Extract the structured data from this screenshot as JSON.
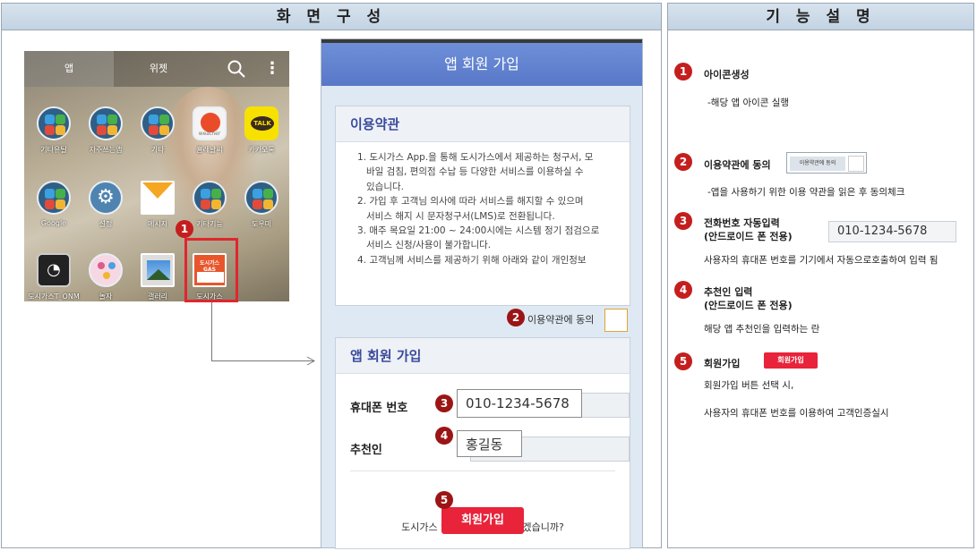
{
  "left_panel": {
    "title": "화 면 구 성"
  },
  "right_panel": {
    "title": "기 능 설 명"
  },
  "phone_home": {
    "tabs": [
      "앱",
      "위젯"
    ],
    "apps": [
      {
        "label": "기타유틸",
        "icon": "folder-icon"
      },
      {
        "label": "자주쓰는앱",
        "icon": "folder-icon"
      },
      {
        "label": "기타",
        "icon": "folder-icon"
      },
      {
        "label": "홈레날씨",
        "icon": "weather-icon"
      },
      {
        "label": "카카오톡",
        "icon": "kakaotalk-icon"
      },
      {
        "label": "Google",
        "icon": "folder-icon"
      },
      {
        "label": "설정",
        "icon": "gear-icon"
      },
      {
        "label": "메시지",
        "icon": "mail-icon"
      },
      {
        "label": "기타기능",
        "icon": "folder-icon"
      },
      {
        "label": "도우미",
        "icon": "folder-icon"
      },
      {
        "label": "도시가스T_ONM",
        "icon": "clock-app-icon"
      },
      {
        "label": "놀자",
        "icon": "kids-app-icon"
      },
      {
        "label": "갤러리",
        "icon": "gallery-icon"
      },
      {
        "label": "도시가스",
        "icon": "gas-app-icon"
      }
    ],
    "weather_text": "weather",
    "talk_text": "TALK",
    "gas_text": "도시가스\nGAS"
  },
  "form": {
    "title": "앱 회원 가입",
    "terms": {
      "heading": "이용약관",
      "items": [
        "1. 도시가스 App.을 통해 도시가스에서 제공하는 청구서, 모",
        "바일 검침, 편의점 수납 등 다양한 서비스를 이용하실 수",
        "있습니다.",
        "2. 가입 후 고객님 의사에 따라 서비스를 해지할 수 있으며",
        "서비스 해지 시 문자청구서(LMS)로 전환됩니다.",
        "3. 매주 목요일 21:00 ~ 24:00시에는 시스템 정기 점검으로",
        "서비스 신청/사용이 불가합니다.",
        "4. 고객님께 서비스를 제공하기 위해 아래와 같이 개인정보"
      ]
    },
    "agree_label": "이용약관에 동의",
    "join": {
      "heading": "앱 회원 가입",
      "phone_label": "휴대폰 번호",
      "phone_value": "010-1234-5678",
      "referrer_label": "추천인",
      "referrer_value": "홍길동",
      "question": "도시가스 앱 회원 가입을 하시겠습니까?",
      "button": "회원가입"
    }
  },
  "badges": [
    "1",
    "2",
    "3",
    "4",
    "5"
  ],
  "descriptions": [
    {
      "num": "1",
      "title": "아이콘생성",
      "text": "-해당 앱 아이콘 실행"
    },
    {
      "num": "2",
      "title": "이용약관에 동의",
      "mini": "이용약관에 동의",
      "text": "-앱을 사용하기 위한 이용 약관을 읽은 후 동의체크"
    },
    {
      "num": "3",
      "title": "전화번호 자동입력",
      "title2": "(안드로이드 폰 전용)",
      "mini": "010-1234-5678",
      "text": "사용자의 휴대폰 번호를 기기에서 자동으로호출하여 입력 됨"
    },
    {
      "num": "4",
      "title": "추천인 입력",
      "title2": "(안드로이드 폰 전용)",
      "text": "해당 앱 추천인을 입력하는 란"
    },
    {
      "num": "5",
      "title": "회원가입",
      "mini": "회원가입",
      "text": "회원가입 버튼 선택 시,",
      "text2": "사용자의 휴대폰 번호를 이용하여 고객인증실시"
    }
  ]
}
